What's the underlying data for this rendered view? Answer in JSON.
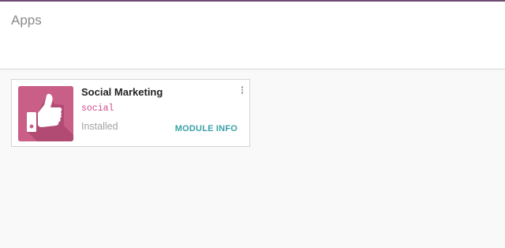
{
  "header": {
    "title": "Apps"
  },
  "apps": [
    {
      "name": "Social Marketing",
      "technical_name": "social",
      "status": "Installed",
      "info_link_label": "MODULE INFO",
      "icon": "thumbs-up-icon"
    }
  ],
  "colors": {
    "brand_bar": "#6f4c73",
    "icon_bg": "#c95e86",
    "technical_name": "#c94f8c",
    "link": "#3aa1a6",
    "status": "#a3a3a3"
  }
}
